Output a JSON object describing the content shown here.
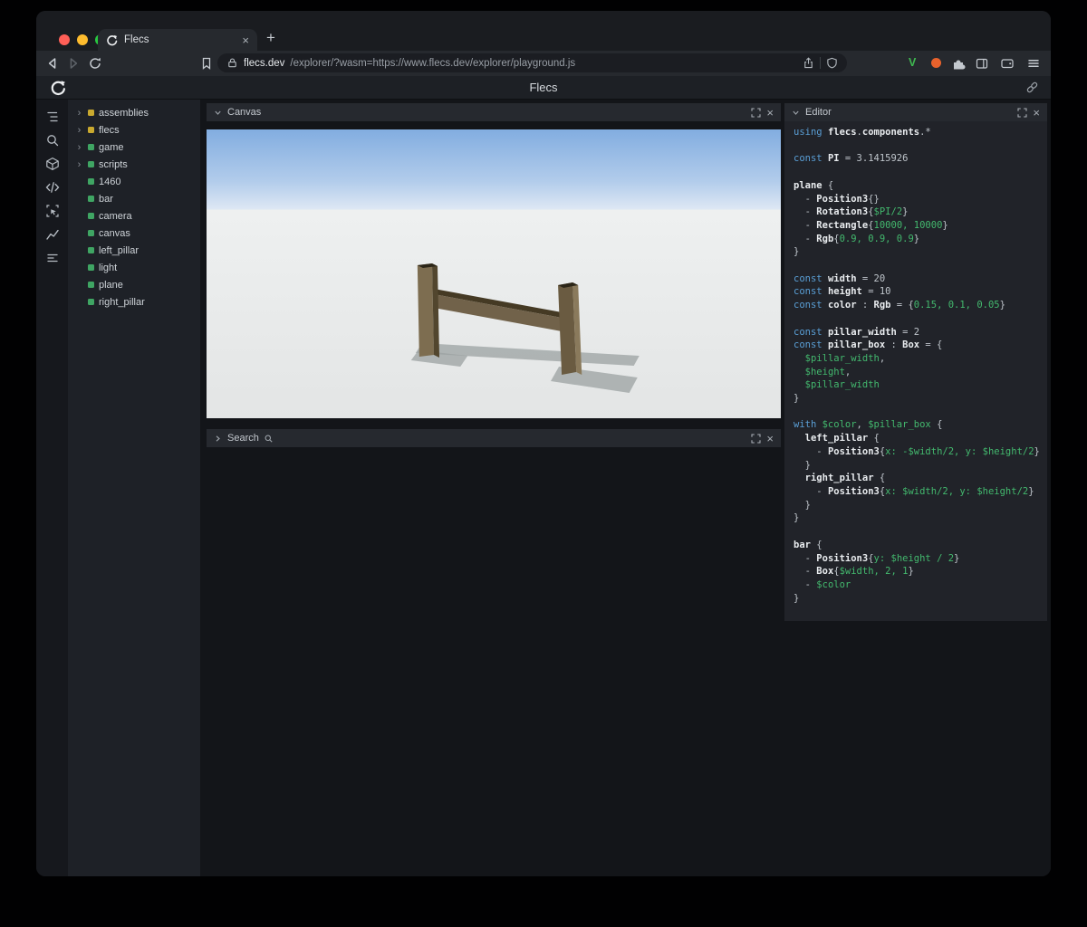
{
  "browser": {
    "tab_title": "Flecs",
    "new_tab_label": "+",
    "url_domain": "flecs.dev",
    "url_path": "/explorer/?wasm=https://www.flecs.dev/explorer/playground.js",
    "toolbar_icons": [
      "back-icon",
      "forward-icon",
      "reload-icon",
      "bookmark-icon",
      "lock-icon",
      "share-icon",
      "shield-icon",
      "v-extension-icon",
      "orange-dot-icon",
      "puzzle-icon",
      "sidebar-toggle-icon",
      "wallet-icon",
      "menu-icon"
    ]
  },
  "app": {
    "title": "Flecs",
    "sidebar_icons": [
      "entity-tree-icon",
      "search-icon",
      "cube-icon",
      "code-icon",
      "inspect-icon",
      "chart-icon",
      "stats-icon"
    ],
    "header_icons": [
      "flecs-logo",
      "link-icon"
    ]
  },
  "panels": {
    "canvas_title": "Canvas",
    "search_title": "Search",
    "editor_title": "Editor"
  },
  "tree": {
    "items": [
      {
        "label": "assemblies",
        "color": "#c9a92f",
        "expandable": true
      },
      {
        "label": "flecs",
        "color": "#c9a92f",
        "expandable": true
      },
      {
        "label": "game",
        "color": "#3fa563",
        "expandable": true
      },
      {
        "label": "scripts",
        "color": "#3fa563",
        "expandable": true
      },
      {
        "label": "1460",
        "color": "#3fa563",
        "expandable": false
      },
      {
        "label": "bar",
        "color": "#3fa563",
        "expandable": false
      },
      {
        "label": "camera",
        "color": "#3fa563",
        "expandable": false
      },
      {
        "label": "canvas",
        "color": "#3fa563",
        "expandable": false
      },
      {
        "label": "left_pillar",
        "color": "#3fa563",
        "expandable": false
      },
      {
        "label": "light",
        "color": "#3fa563",
        "expandable": false
      },
      {
        "label": "plane",
        "color": "#3fa563",
        "expandable": false
      },
      {
        "label": "right_pillar",
        "color": "#3fa563",
        "expandable": false
      }
    ]
  },
  "scene": {
    "sky_top": "#82ade0",
    "sky_mid": "#b2cceb",
    "sky_horizon": "#dde7f4",
    "ground": "#eef0f0",
    "ground_far": "#e3e5e5",
    "shadow": "#9ba1a2",
    "pillar_lit": "#7d6d50",
    "pillar_shade": "#52462e",
    "pillar_top": "#2b2517",
    "pillar_front2": "#6a5b41",
    "pillar_rim": "#8a7a5c",
    "bar_top": "#453a24",
    "bar_front": "#71624a"
  },
  "editor": {
    "lines": [
      [
        [
          "k",
          "using "
        ],
        [
          "i",
          "flecs"
        ],
        [
          "p",
          "."
        ],
        [
          "i",
          "components"
        ],
        [
          "p",
          ".*"
        ]
      ],
      [],
      [
        [
          "k",
          "const "
        ],
        [
          "i",
          "PI"
        ],
        [
          "p",
          " = 3.1415926"
        ]
      ],
      [],
      [
        [
          "i",
          "plane"
        ],
        [
          "p",
          " {"
        ]
      ],
      [
        [
          "p",
          "  - "
        ],
        [
          "i",
          "Position3"
        ],
        [
          "p",
          "{}"
        ]
      ],
      [
        [
          "p",
          "  - "
        ],
        [
          "i",
          "Rotation3"
        ],
        [
          "p",
          "{"
        ],
        [
          "g",
          "$PI/2"
        ],
        [
          "p",
          "}"
        ]
      ],
      [
        [
          "p",
          "  - "
        ],
        [
          "i",
          "Rectangle"
        ],
        [
          "p",
          "{"
        ],
        [
          "g",
          "10000, 10000"
        ],
        [
          "p",
          "}"
        ]
      ],
      [
        [
          "p",
          "  - "
        ],
        [
          "i",
          "Rgb"
        ],
        [
          "p",
          "{"
        ],
        [
          "g",
          "0.9, 0.9, 0.9"
        ],
        [
          "p",
          "}"
        ]
      ],
      [
        [
          "p",
          "}"
        ]
      ],
      [],
      [
        [
          "k",
          "const "
        ],
        [
          "i",
          "width"
        ],
        [
          "p",
          " = 20"
        ]
      ],
      [
        [
          "k",
          "const "
        ],
        [
          "i",
          "height"
        ],
        [
          "p",
          " = 10"
        ]
      ],
      [
        [
          "k",
          "const "
        ],
        [
          "i",
          "color"
        ],
        [
          "p",
          " : "
        ],
        [
          "i",
          "Rgb"
        ],
        [
          "p",
          " = {"
        ],
        [
          "g",
          "0.15, 0.1, 0.05"
        ],
        [
          "p",
          "}"
        ]
      ],
      [],
      [
        [
          "k",
          "const "
        ],
        [
          "i",
          "pillar_width"
        ],
        [
          "p",
          " = 2"
        ]
      ],
      [
        [
          "k",
          "const "
        ],
        [
          "i",
          "pillar_box"
        ],
        [
          "p",
          " : "
        ],
        [
          "i",
          "Box"
        ],
        [
          "p",
          " = {"
        ]
      ],
      [
        [
          "p",
          "  "
        ],
        [
          "g",
          "$pillar_width"
        ],
        [
          "p",
          ","
        ]
      ],
      [
        [
          "p",
          "  "
        ],
        [
          "g",
          "$height"
        ],
        [
          "p",
          ","
        ]
      ],
      [
        [
          "p",
          "  "
        ],
        [
          "g",
          "$pillar_width"
        ]
      ],
      [
        [
          "p",
          "}"
        ]
      ],
      [],
      [
        [
          "k",
          "with "
        ],
        [
          "g",
          "$color"
        ],
        [
          "p",
          ", "
        ],
        [
          "g",
          "$pillar_box"
        ],
        [
          "p",
          " {"
        ]
      ],
      [
        [
          "p",
          "  "
        ],
        [
          "i",
          "left_pillar"
        ],
        [
          "p",
          " {"
        ]
      ],
      [
        [
          "p",
          "    - "
        ],
        [
          "i",
          "Position3"
        ],
        [
          "p",
          "{"
        ],
        [
          "g",
          "x: -$width/2, y: $height/2"
        ],
        [
          "p",
          "}"
        ]
      ],
      [
        [
          "p",
          "  }"
        ]
      ],
      [
        [
          "p",
          "  "
        ],
        [
          "i",
          "right_pillar"
        ],
        [
          "p",
          " {"
        ]
      ],
      [
        [
          "p",
          "    - "
        ],
        [
          "i",
          "Position3"
        ],
        [
          "p",
          "{"
        ],
        [
          "g",
          "x: $width/2, y: $height/2"
        ],
        [
          "p",
          "}"
        ]
      ],
      [
        [
          "p",
          "  }"
        ]
      ],
      [
        [
          "p",
          "}"
        ]
      ],
      [],
      [
        [
          "i",
          "bar"
        ],
        [
          "p",
          " {"
        ]
      ],
      [
        [
          "p",
          "  - "
        ],
        [
          "i",
          "Position3"
        ],
        [
          "p",
          "{"
        ],
        [
          "g",
          "y: $height / 2"
        ],
        [
          "p",
          "}"
        ]
      ],
      [
        [
          "p",
          "  - "
        ],
        [
          "i",
          "Box"
        ],
        [
          "p",
          "{"
        ],
        [
          "g",
          "$width, 2, 1"
        ],
        [
          "p",
          "}"
        ]
      ],
      [
        [
          "p",
          "  - "
        ],
        [
          "g",
          "$color"
        ]
      ],
      [
        [
          "p",
          "}"
        ]
      ]
    ]
  }
}
